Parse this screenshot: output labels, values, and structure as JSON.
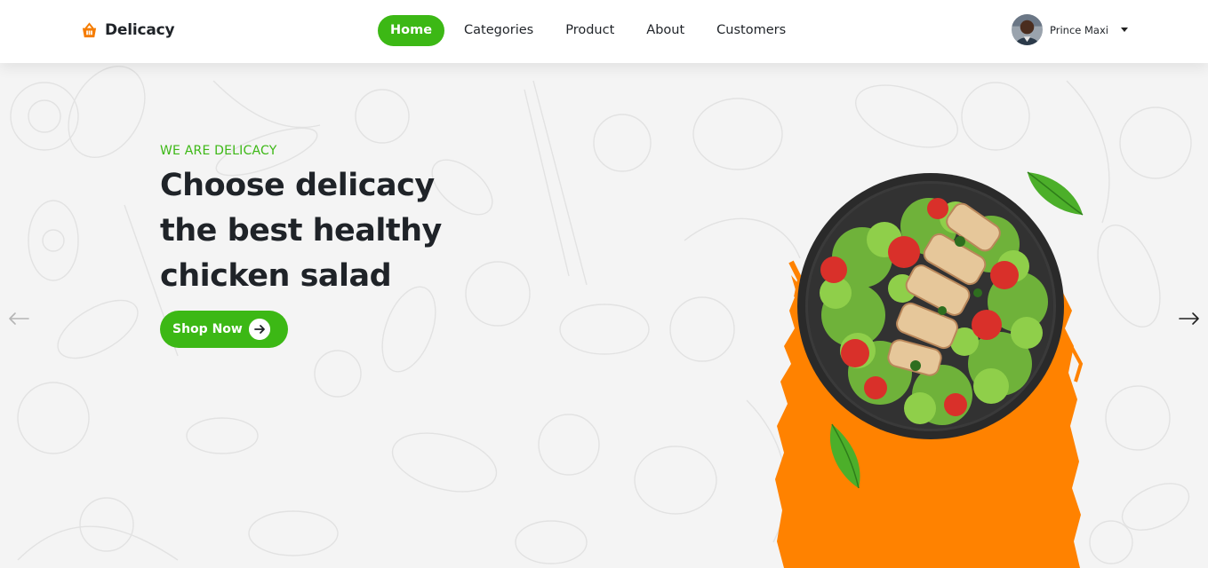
{
  "brand": {
    "name": "Delicacy",
    "icon": "basket-icon",
    "accent": "#f57c00"
  },
  "nav": {
    "items": [
      {
        "label": "Home",
        "active": true
      },
      {
        "label": "Categories",
        "active": false
      },
      {
        "label": "Product",
        "active": false
      },
      {
        "label": "About",
        "active": false
      },
      {
        "label": "Customers",
        "active": false
      }
    ]
  },
  "user": {
    "name": "Prince Maxi",
    "avatar": "avatar-photo",
    "menu_icon": "caret-down-icon"
  },
  "hero": {
    "eyebrow": "WE ARE DELICACY",
    "headline": [
      "Choose delicacy",
      "the best healthy",
      "chicken salad"
    ],
    "cta_label": "Shop Now",
    "cta_icon": "arrow-right-icon"
  },
  "carousel": {
    "prev_icon": "arrow-left-icon",
    "next_icon": "arrow-right-icon"
  },
  "colors": {
    "primary": "#3cb815",
    "orange": "#ff8200",
    "text": "#1f2328",
    "background": "#f4f4f4"
  }
}
